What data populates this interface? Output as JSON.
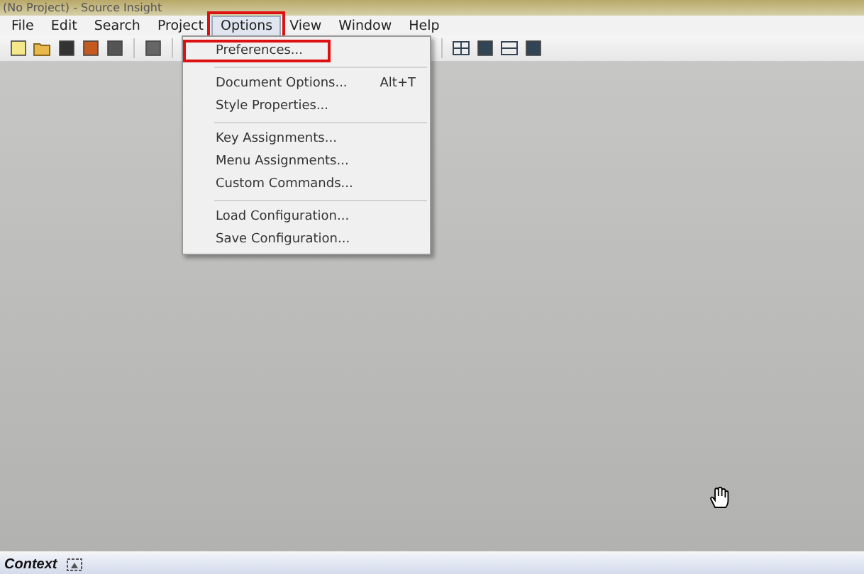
{
  "window": {
    "title": "(No Project) - Source Insight"
  },
  "menu_bar": [
    {
      "label": "File",
      "selected": false,
      "highlighted": false
    },
    {
      "label": "Edit",
      "selected": false,
      "highlighted": false
    },
    {
      "label": "Search",
      "selected": false,
      "highlighted": false
    },
    {
      "label": "Project",
      "selected": false,
      "highlighted": false
    },
    {
      "label": "Options",
      "selected": true,
      "highlighted": true
    },
    {
      "label": "View",
      "selected": false,
      "highlighted": false
    },
    {
      "label": "Window",
      "selected": false,
      "highlighted": false
    },
    {
      "label": "Help",
      "selected": false,
      "highlighted": false
    }
  ],
  "dropdown": {
    "groups": [
      [
        {
          "label": "Preferences...",
          "highlighted": true
        }
      ],
      [
        {
          "label": "Document Options...",
          "shortcut": "Alt+T",
          "highlighted": false
        },
        {
          "label": "Style Properties...",
          "highlighted": false
        }
      ],
      [
        {
          "label": "Key Assignments...",
          "highlighted": false
        },
        {
          "label": "Menu Assignments...",
          "highlighted": false
        },
        {
          "label": "Custom Commands...",
          "highlighted": false
        }
      ],
      [
        {
          "label": "Load Configuration...",
          "highlighted": false
        },
        {
          "label": "Save Configuration...",
          "highlighted": false
        }
      ]
    ]
  },
  "status_bar": {
    "label": "Context"
  }
}
